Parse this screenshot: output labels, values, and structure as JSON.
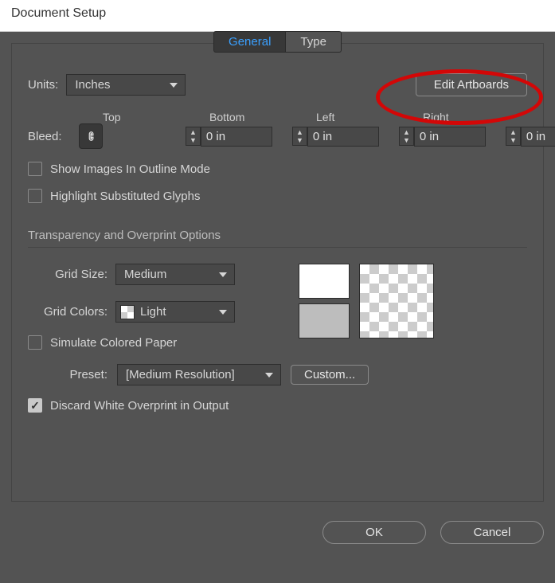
{
  "window_title": "Document Setup",
  "tabs": {
    "general": "General",
    "type": "Type"
  },
  "units_label": "Units:",
  "units_value": "Inches",
  "edit_artboards": "Edit Artboards",
  "bleed": {
    "label": "Bleed:",
    "headers": {
      "top": "Top",
      "bottom": "Bottom",
      "left": "Left",
      "right": "Right"
    },
    "values": {
      "top": "0 in",
      "bottom": "0 in",
      "left": "0 in",
      "right": "0 in"
    }
  },
  "show_images_outline": "Show Images In Outline Mode",
  "highlight_sub_glyphs": "Highlight Substituted Glyphs",
  "transparency_title": "Transparency and Overprint Options",
  "grid_size_label": "Grid Size:",
  "grid_size_value": "Medium",
  "grid_colors_label": "Grid Colors:",
  "grid_colors_value": "Light",
  "simulate_paper": "Simulate Colored Paper",
  "preset_label": "Preset:",
  "preset_value": "[Medium Resolution]",
  "custom_btn": "Custom...",
  "discard_white": "Discard White Overprint in Output",
  "ok": "OK",
  "cancel": "Cancel"
}
